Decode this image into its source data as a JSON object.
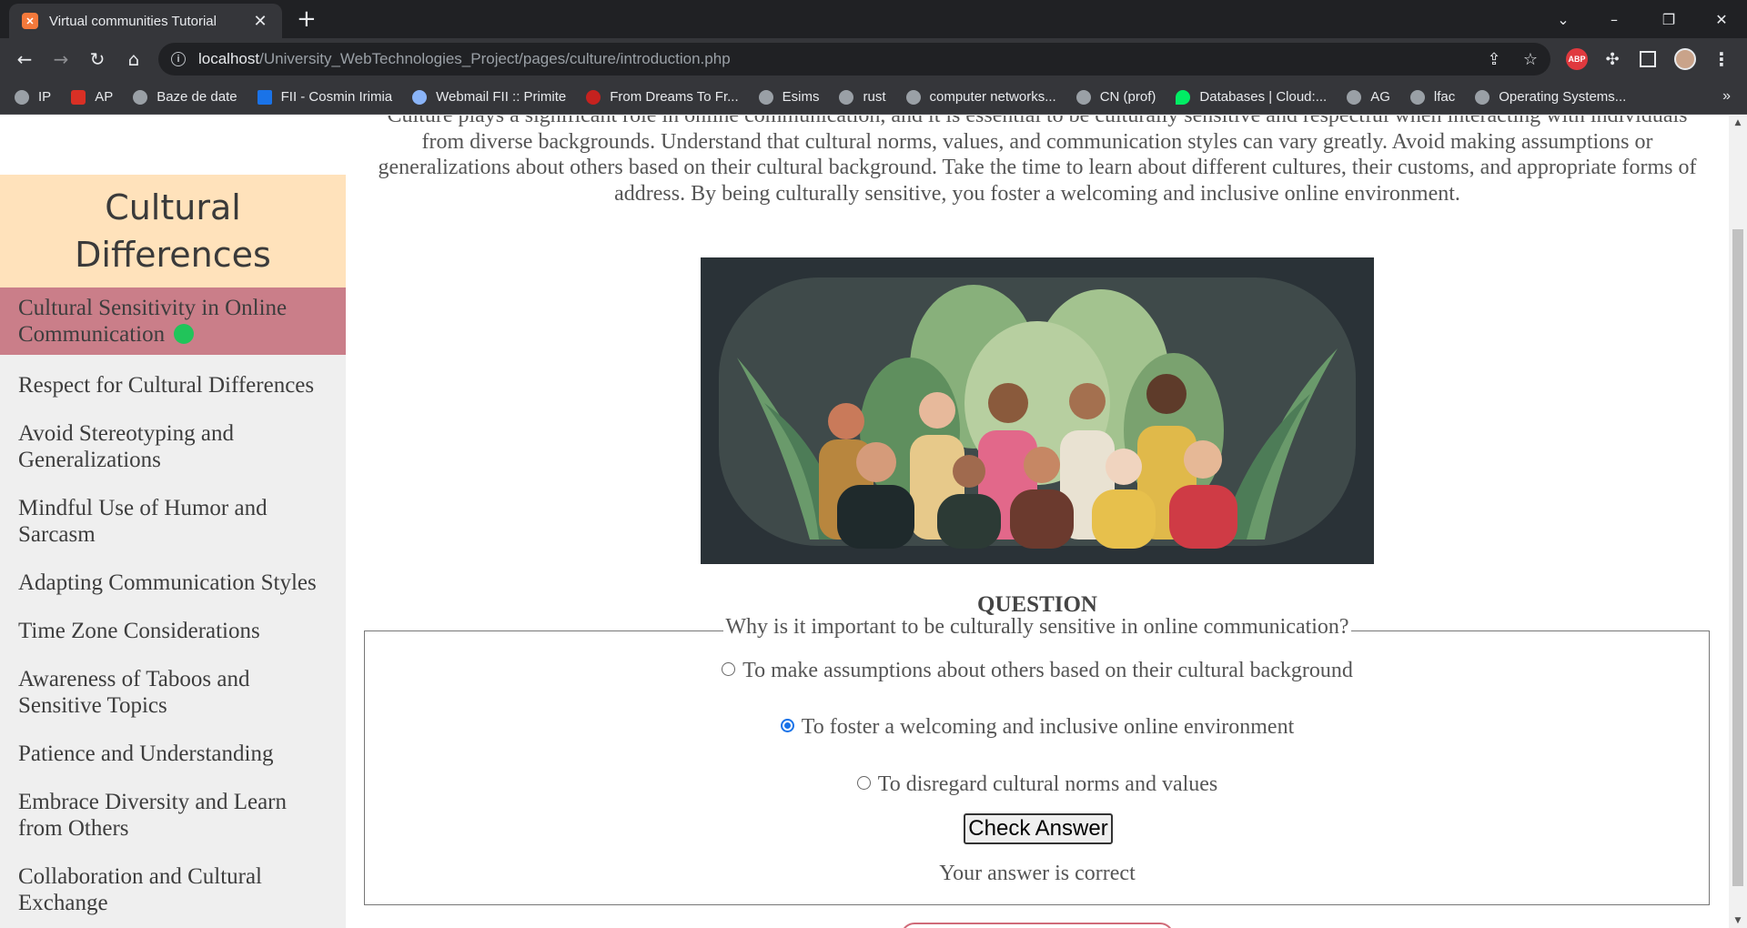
{
  "browser": {
    "tab_title": "Virtual communities Tutorial",
    "tab_favicon": "XAMPP",
    "url_host": "localhost",
    "url_path": "/University_WebTechnologies_Project/pages/culture/introduction.php",
    "bookmarks": [
      "IP",
      "AP",
      "Baze de date",
      "FII - Cosmin Irimia",
      "Webmail FII :: Primite",
      "From Dreams To Fr...",
      "Esims",
      "rust",
      "computer networks...",
      "CN (prof)",
      "Databases | Cloud:...",
      "AG",
      "lfac",
      "Operating Systems..."
    ],
    "bookmarks_more": "»",
    "extension_abp": "ABP"
  },
  "sidebar": {
    "title": "Cultural Differences",
    "items": [
      {
        "label": "Cultural Sensitivity in Online Communication",
        "active": true
      },
      {
        "label": "Respect for Cultural Differences"
      },
      {
        "label": "Avoid Stereotyping and Generalizations"
      },
      {
        "label": "Mindful Use of Humor and Sarcasm"
      },
      {
        "label": "Adapting Communication Styles"
      },
      {
        "label": "Time Zone Considerations"
      },
      {
        "label": "Awareness of Taboos and Sensitive Topics"
      },
      {
        "label": "Patience and Understanding"
      },
      {
        "label": "Embrace Diversity and Learn from Others"
      },
      {
        "label": "Collaboration and Cultural Exchange"
      }
    ]
  },
  "main": {
    "intro": "Culture plays a significant role in online communication, and it is essential to be culturally sensitive and respectful when interacting with individuals from diverse backgrounds. Understand that cultural norms, values, and communication styles can vary greatly. Avoid making assumptions or generalizations about others based on their cultural background. Take the time to learn about different cultures, their customs, and appropriate forms of address. By being culturally sensitive, you foster a welcoming and inclusive online environment.",
    "question_title": "QUESTION",
    "question": "Why is it important to be culturally sensitive in online communication?",
    "options": [
      {
        "label": "To make assumptions about others based on their cultural background",
        "checked": false
      },
      {
        "label": "To foster a welcoming and inclusive online environment",
        "checked": true
      },
      {
        "label": "To disregard cultural norms and values",
        "checked": false
      }
    ],
    "check_button": "Check Answer",
    "result": "Your answer is correct"
  },
  "colors": {
    "sidebar_header": "#ffe2bb",
    "sidebar_active": "#ca7e89",
    "active_dot": "#21c45a",
    "radio_checked": "#1a73e8"
  }
}
